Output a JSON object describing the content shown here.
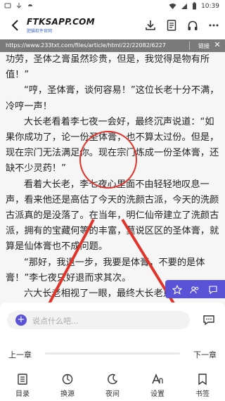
{
  "status_bar": {
    "time": "10:39"
  },
  "appbar": {
    "logo_text": "FTKSAPP.COM",
    "logo_sub": "肥猫软件官网"
  },
  "url_bar": {
    "url": "https://www.233txt.com/files/article/html/22/22082/6227",
    "link": "链接"
  },
  "content": {
    "paragraphs": [
      "功劳，圣体之膏虽然珍贵，但是，我觉得是物有所值！”",
      "“哼，圣体膏，谈何容易！”这位长老十分不满，冷哼一声！",
      "大长老看着李七夜一会好，最终沉声说道：“如果你成功了，论一份圣体膏，也不算太过份。但是，现在宗门无法满足你。现在宗门炼成一份圣体膏，还缺不少灵药！”",
      "看着大长老，李七夜心里面不由轻轻地叹息一声，看来他还是高估了今天的洗颜古派，今天的洗颜古派真的是没落了。在当年，明仁仙帝建立了洗颜古派，拥有的宝藏何等的丰富，莫说区区的圣体膏，就算是仙体膏也不成问题。",
      "“那好，我退一步，我要是体膏，不要的是体膏！”李七夜只好退而求其次。",
      "六大长老相视了一眼，最终大长老点头说道：“这个我可以答应你，前提你能成功！”"
    ]
  },
  "comment": {
    "placeholder": "说点什么吧..."
  },
  "chapter_nav": {
    "prev": "上一章",
    "next": "下一章"
  },
  "toolbar": {
    "items": [
      {
        "label": "目录",
        "icon": "catalog-icon"
      },
      {
        "label": "换源",
        "icon": "switch-source-icon"
      },
      {
        "label": "夜间",
        "icon": "moon-icon"
      },
      {
        "label": "设置",
        "icon": "font-settings-icon"
      },
      {
        "label": "书签",
        "icon": "bookmark-icon"
      }
    ]
  },
  "colors": {
    "accent": "#5b53d6",
    "annotation": "#e0342a",
    "url_bar": "#7a7a7a"
  }
}
